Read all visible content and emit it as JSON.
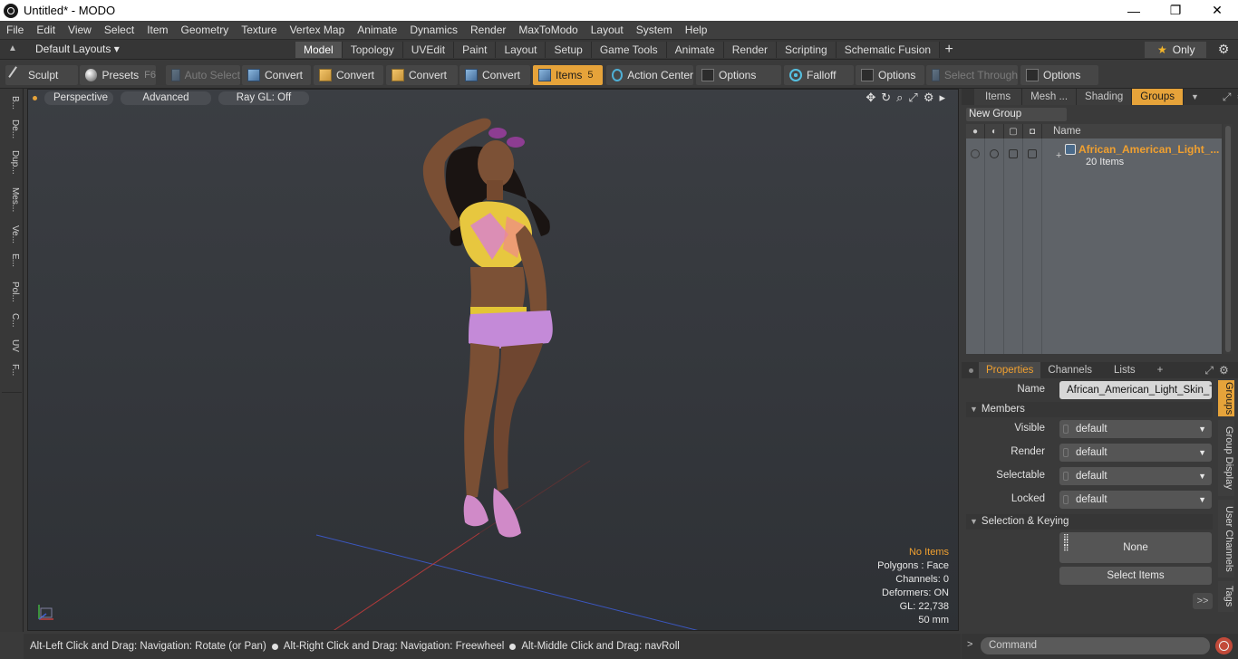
{
  "window": {
    "title": "Untitled* - MODO",
    "controls": [
      "—",
      "❐",
      "✕"
    ]
  },
  "menu": [
    "File",
    "Edit",
    "View",
    "Select",
    "Item",
    "Geometry",
    "Texture",
    "Vertex Map",
    "Animate",
    "Dynamics",
    "Render",
    "MaxToModo",
    "Layout",
    "System",
    "Help"
  ],
  "layoutbar": {
    "layouts_label": "Default Layouts ▾",
    "tabs": [
      "Model",
      "Topology",
      "UVEdit",
      "Paint",
      "Layout",
      "Setup",
      "Game Tools",
      "Animate",
      "Render",
      "Scripting",
      "Schematic Fusion"
    ],
    "active_tab": "Model",
    "plus": "+",
    "only_label": "Only",
    "only_star": "★",
    "gear": "⚙"
  },
  "toolbar": {
    "sculpt": "Sculpt",
    "presets": "Presets",
    "presets_key": "F6",
    "auto_select": "Auto Select",
    "convert1": "Convert",
    "convert2": "Convert",
    "convert3": "Convert",
    "convert4": "Convert",
    "items": "Items",
    "items_key": "5",
    "action_center": "Action Center",
    "options1": "Options",
    "falloff": "Falloff",
    "options2": "Options",
    "select_through": "Select Through",
    "options3": "Options"
  },
  "left_tabs": [
    "B...",
    "De...",
    "Dup...",
    "Mes...",
    "Ve...",
    "E...",
    "Pol...",
    "C...",
    "UV",
    "F..."
  ],
  "viewport": {
    "perspective": "Perspective",
    "advanced": "Advanced",
    "raygl": "Ray GL: Off",
    "icons": [
      "✥",
      "↻",
      "⌕",
      "⤢",
      "⚙",
      "▸"
    ],
    "stats": {
      "no_items": "No Items",
      "polygons": "Polygons : Face",
      "channels": "Channels: 0",
      "deformers": "Deformers: ON",
      "gl": "GL: 22,738",
      "lens": "50 mm"
    }
  },
  "helpbar": {
    "part1": "Alt-Left Click and Drag: Navigation: Rotate (or Pan)",
    "part2": "Alt-Right Click and Drag: Navigation: Freewheel",
    "part3": "Alt-Middle Click and Drag: navRoll"
  },
  "right_panel": {
    "tabs": [
      "Items",
      "Mesh ...",
      "Shading",
      "Groups"
    ],
    "active_tab": "Groups",
    "new_group": "New Group",
    "list_header": "Name",
    "group": {
      "name": "African_American_Light_...",
      "count": "20 Items"
    },
    "props_tabs": [
      "Properties",
      "Channels",
      "Lists",
      "+"
    ],
    "props_active": "Properties",
    "name_label": "Name",
    "name_value": "African_American_Light_Skin_Te",
    "members_section": "Members",
    "visible_label": "Visible",
    "visible_value": "default",
    "render_label": "Render",
    "render_value": "default",
    "selectable_label": "Selectable",
    "selectable_value": "default",
    "locked_label": "Locked",
    "locked_value": "default",
    "selection_section": "Selection & Keying",
    "none_btn": "None",
    "select_items_btn": "Select Items",
    "more_btn": ">>",
    "side_tabs": [
      "Groups",
      "Group Display",
      "User Channels",
      "Tags"
    ]
  },
  "command": {
    "arrow": ">",
    "placeholder": "Command"
  },
  "colors": {
    "accent": "#e6a33a",
    "group_name": "#f0a030"
  }
}
